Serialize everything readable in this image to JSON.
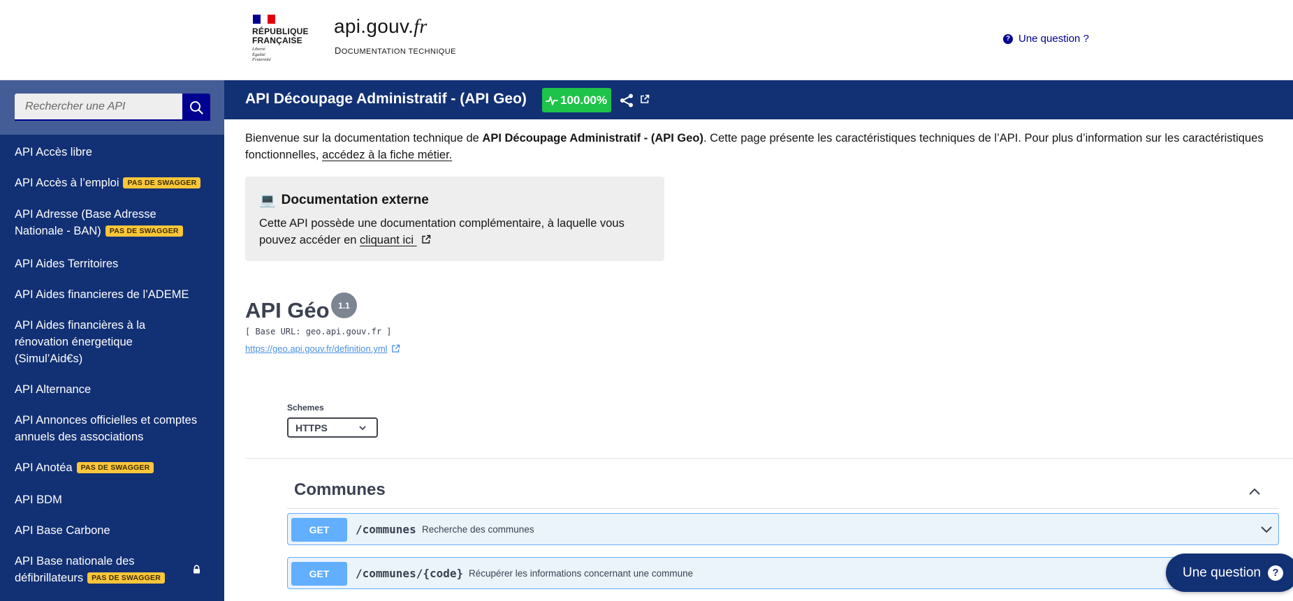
{
  "header": {
    "republic_line1": "RÉPUBLIQUE",
    "republic_line2": "FRANÇAISE",
    "motto_1": "Liberté",
    "motto_2": "Égalité",
    "motto_3": "Fraternité",
    "site_name_main": "api",
    "site_name_dot": ".gouv.",
    "site_name_fr": "fr",
    "subtitle_first": "D",
    "subtitle_rest": "OCUMENTATION TECHNIQUE",
    "question_link": "Une question ?"
  },
  "sidebar": {
    "search_placeholder": "Rechercher une API",
    "items": [
      {
        "label": "API Accès libre",
        "badge": ""
      },
      {
        "label": "API Accès à l’emploi",
        "badge": "PAS DE SWAGGER"
      },
      {
        "label": "API Adresse (Base Adresse Nationale - BAN)",
        "badge": "PAS DE SWAGGER"
      },
      {
        "label": "API Aides Territoires",
        "badge": ""
      },
      {
        "label": "API Aides financieres de l’ADEME",
        "badge": ""
      },
      {
        "label": "API Aides financières à la rénovation énergetique (Simul’Aid€s)",
        "badge": ""
      },
      {
        "label": "API Alternance",
        "badge": ""
      },
      {
        "label": "API Annonces officielles et comptes annuels des associations",
        "badge": ""
      },
      {
        "label": "API Anotéa",
        "badge": "PAS DE SWAGGER"
      },
      {
        "label": "API BDM",
        "badge": ""
      },
      {
        "label": "API Base Carbone",
        "badge": ""
      },
      {
        "label": "API Base nationale des défibrillateurs",
        "badge": "PAS DE SWAGGER"
      }
    ]
  },
  "topbar": {
    "title": "API Découpage Administratif - (API Geo)",
    "uptime": "100.00%"
  },
  "intro": {
    "before": "Bienvenue sur la documentation technique de ",
    "api_name": "API Découpage Administratif - (API Geo)",
    "after": ". Cette page présente les caractéristiques techniques de l’API. Pour plus d’information sur les caractéristiques",
    "line2": "fonctionnelles, ",
    "link": "accédez à la fiche métier."
  },
  "external_doc": {
    "emoji": "💻",
    "title": "Documentation externe",
    "text_line1": "Cette API possède une documentation complémentaire, à laquelle vous",
    "text_line2": "pouvez accéder en ",
    "link": "cliquant ici"
  },
  "swagger": {
    "title": "API Géo",
    "version": "1.1",
    "base_url": "[ Base URL: geo.api.gouv.fr ]",
    "definition_link": "https://geo.api.gouv.fr/definition.yml",
    "schemes_label": "Schemes",
    "scheme_selected": "HTTPS",
    "tag": "Communes",
    "operations": [
      {
        "method": "GET",
        "path": "/communes",
        "summary": "Recherche des communes"
      },
      {
        "method": "GET",
        "path": "/communes/{code}",
        "summary": "Récupérer les informations concernant une commune"
      }
    ]
  },
  "chat": {
    "label": "Une question",
    "icon": "?"
  },
  "colors": {
    "brand_blue": "#000091",
    "sidebar_bg": "#123074",
    "badge_yellow": "#fcc63a",
    "uptime_green": "#1ec349",
    "get_blue": "#61affe"
  }
}
